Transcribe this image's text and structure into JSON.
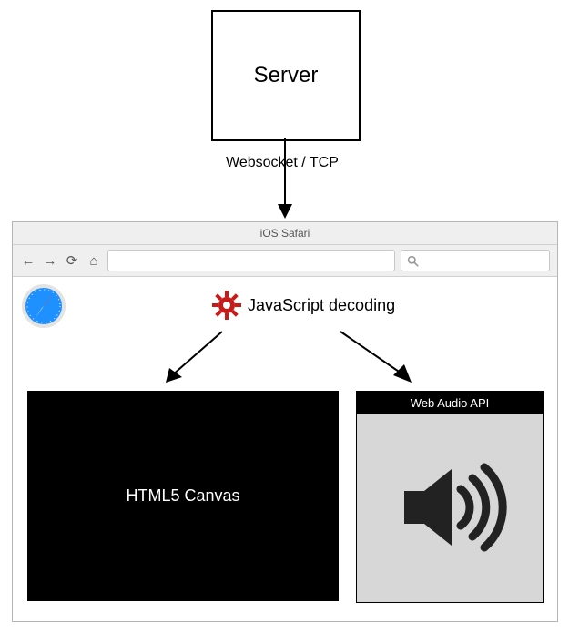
{
  "server": {
    "label": "Server"
  },
  "connection": {
    "label": "Websocket / TCP"
  },
  "browser": {
    "title": "iOS Safari",
    "nav": {
      "back": "←",
      "forward": "→",
      "reload": "⟳",
      "home": "⌂"
    },
    "search_placeholder": "Search"
  },
  "decoding": {
    "label": "JavaScript decoding"
  },
  "canvas": {
    "label": "HTML5 Canvas"
  },
  "audio": {
    "title": "Web Audio API"
  },
  "icons": {
    "gear": "gear-icon",
    "safari": "safari-icon",
    "speaker": "speaker-icon",
    "magnifier": "magnifier-icon"
  },
  "colors": {
    "accent_red": "#c91a1a"
  }
}
